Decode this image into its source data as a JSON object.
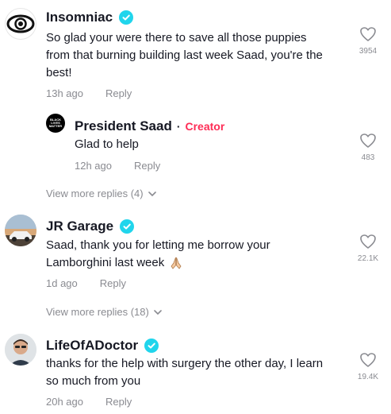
{
  "colors": {
    "verified": "#20d5ec",
    "creator": "#fe2c55",
    "muted": "#8a8b91",
    "text": "#161823"
  },
  "comments": [
    {
      "username": "Insomniac",
      "verified": true,
      "avatar_icon": "eye-logo-icon",
      "text_line1": "So glad your were there to save all those puppies",
      "text_line2": "from that burning building last week Saad, you're the",
      "text_line3": "best!",
      "time": "13h ago",
      "reply_label": "Reply",
      "likes": "3954",
      "reply": {
        "username": "President Saad",
        "separator": "·",
        "role": "Creator",
        "avatar_text_1": "BLACK",
        "avatar_text_2": "LIVES",
        "avatar_text_3": "MATTER",
        "text": "Glad to help",
        "time": "12h ago",
        "reply_label": "Reply",
        "likes": "483"
      },
      "view_more": "View more replies (4)"
    },
    {
      "username": "JR Garage",
      "verified": true,
      "avatar_icon": "car-photo-avatar",
      "text_line1": "Saad, thank you for letting me borrow your",
      "text_line2": "Lamborghini last week",
      "time": "1d ago",
      "reply_label": "Reply",
      "likes": "22.1K",
      "view_more": "View more replies (18)"
    },
    {
      "username": "LifeOfADoctor",
      "verified": true,
      "avatar_icon": "person-photo-avatar",
      "text_line1": "thanks for the help with surgery the other day, I learn",
      "text_line2": "so much from you",
      "time": "20h ago",
      "reply_label": "Reply",
      "likes": "19.4K"
    }
  ]
}
